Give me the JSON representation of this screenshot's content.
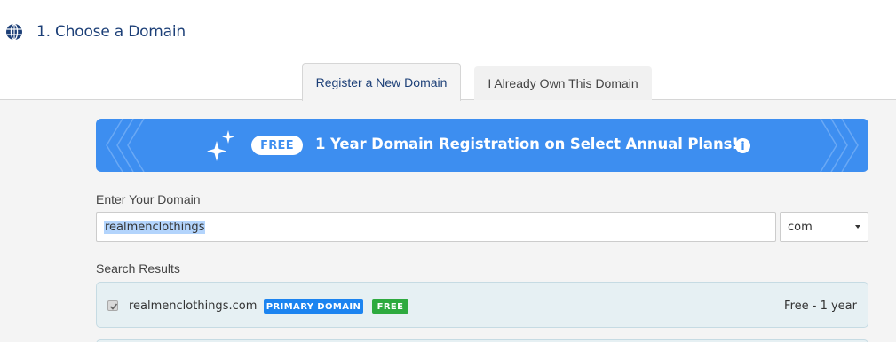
{
  "section": {
    "title": "1. Choose a Domain",
    "icon": "globe-icon"
  },
  "tabs": [
    {
      "label": "Register a New Domain",
      "active": true
    },
    {
      "label": "I Already Own This Domain",
      "active": false
    }
  ],
  "promo": {
    "pill": "FREE",
    "text": "1 Year Domain Registration on Select Annual Plans!",
    "icons": [
      "sparkle-icon",
      "info-icon"
    ],
    "color": "#3d8ef0"
  },
  "domain_form": {
    "label": "Enter Your Domain",
    "value": "realmenclothings",
    "tld": "com"
  },
  "results": {
    "label": "Search Results",
    "items": [
      {
        "domain": "realmenclothings.com",
        "checked": true,
        "badges": [
          "PRIMARY DOMAIN",
          "FREE"
        ],
        "price": "Free - 1 year"
      }
    ]
  },
  "colors": {
    "title": "#1c3f77",
    "primary_badge": "#1c84f0",
    "free_badge": "#2eaa3f"
  }
}
